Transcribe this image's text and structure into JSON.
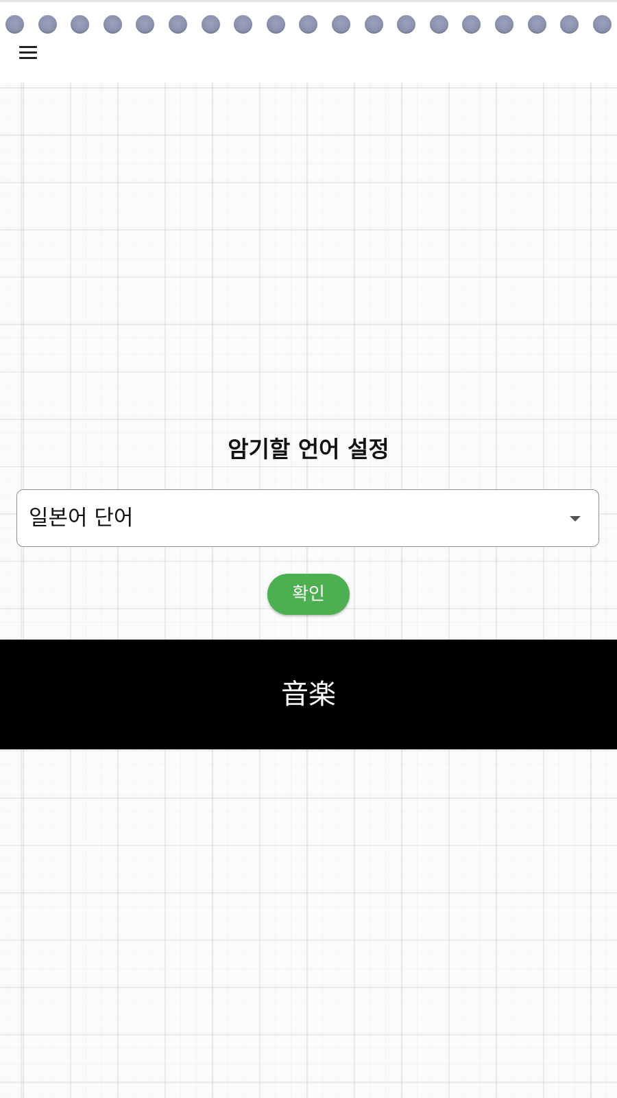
{
  "header": {
    "menu_icon": "hamburger-menu-icon",
    "decoration": "notebook-spiral-rings",
    "ring_color": "#8a91ad"
  },
  "settings": {
    "title": "암기할 언어 설정",
    "language_select": {
      "value": "일본어 단어",
      "icon": "dropdown-arrow-icon"
    },
    "confirm_label": "확인",
    "confirm_color": "#4caf50"
  },
  "word_card": {
    "word": "音楽",
    "background": "#000000",
    "text_color": "#ffffff"
  },
  "background": {
    "pattern": "grid-paper"
  }
}
